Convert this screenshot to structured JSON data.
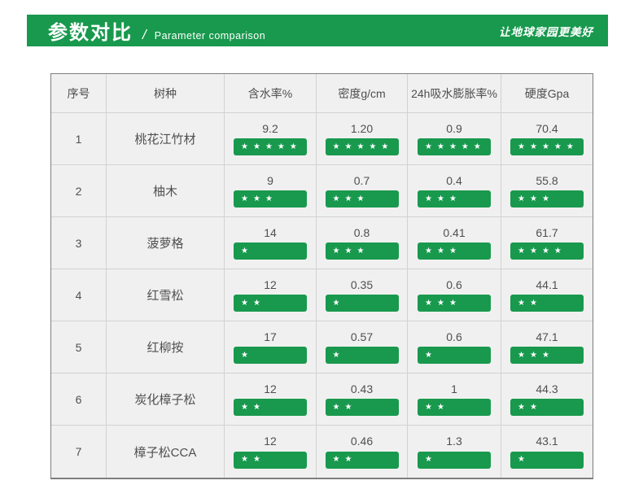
{
  "banner": {
    "title": "参数对比",
    "divider": "/",
    "subtitle": "Parameter comparison",
    "slogan": "让地球家园更美好"
  },
  "icons": {
    "star": "★"
  },
  "colors": {
    "brand_green": "#18994d",
    "cell_background": "#f0f0f0",
    "grid_line": "#d2d2d2",
    "outer_border": "#7e7e7e",
    "text": "#4f4f4f"
  },
  "chart_data": {
    "type": "table",
    "title": "参数对比",
    "subtitle": "Parameter comparison",
    "columns": [
      "序号",
      "树种",
      "含水率%",
      "密度g/cm",
      "24h吸水膨胀率%",
      "硬度Gpa"
    ],
    "max_stars": 5,
    "rows": [
      {
        "index": "1",
        "species": "桃花江竹材",
        "metrics": [
          {
            "value": "9.2",
            "stars": 5
          },
          {
            "value": "1.20",
            "stars": 5
          },
          {
            "value": "0.9",
            "stars": 5
          },
          {
            "value": "70.4",
            "stars": 5
          }
        ]
      },
      {
        "index": "2",
        "species": "柚木",
        "metrics": [
          {
            "value": "9",
            "stars": 3
          },
          {
            "value": "0.7",
            "stars": 3
          },
          {
            "value": "0.4",
            "stars": 3
          },
          {
            "value": "55.8",
            "stars": 3
          }
        ]
      },
      {
        "index": "3",
        "species": "菠萝格",
        "metrics": [
          {
            "value": "14",
            "stars": 1
          },
          {
            "value": "0.8",
            "stars": 3
          },
          {
            "value": "0.41",
            "stars": 3
          },
          {
            "value": "61.7",
            "stars": 4
          }
        ]
      },
      {
        "index": "4",
        "species": "红雪松",
        "metrics": [
          {
            "value": "12",
            "stars": 2
          },
          {
            "value": "0.35",
            "stars": 1
          },
          {
            "value": "0.6",
            "stars": 3
          },
          {
            "value": "44.1",
            "stars": 2
          }
        ]
      },
      {
        "index": "5",
        "species": "红柳按",
        "metrics": [
          {
            "value": "17",
            "stars": 1
          },
          {
            "value": "0.57",
            "stars": 1
          },
          {
            "value": "0.6",
            "stars": 1
          },
          {
            "value": "47.1",
            "stars": 3
          }
        ]
      },
      {
        "index": "6",
        "species": "炭化樟子松",
        "metrics": [
          {
            "value": "12",
            "stars": 2
          },
          {
            "value": "0.43",
            "stars": 2
          },
          {
            "value": "1",
            "stars": 2
          },
          {
            "value": "44.3",
            "stars": 2
          }
        ]
      },
      {
        "index": "7",
        "species": "樟子松CCA",
        "metrics": [
          {
            "value": "12",
            "stars": 2
          },
          {
            "value": "0.46",
            "stars": 2
          },
          {
            "value": "1.3",
            "stars": 1
          },
          {
            "value": "43.1",
            "stars": 1
          }
        ]
      }
    ]
  }
}
